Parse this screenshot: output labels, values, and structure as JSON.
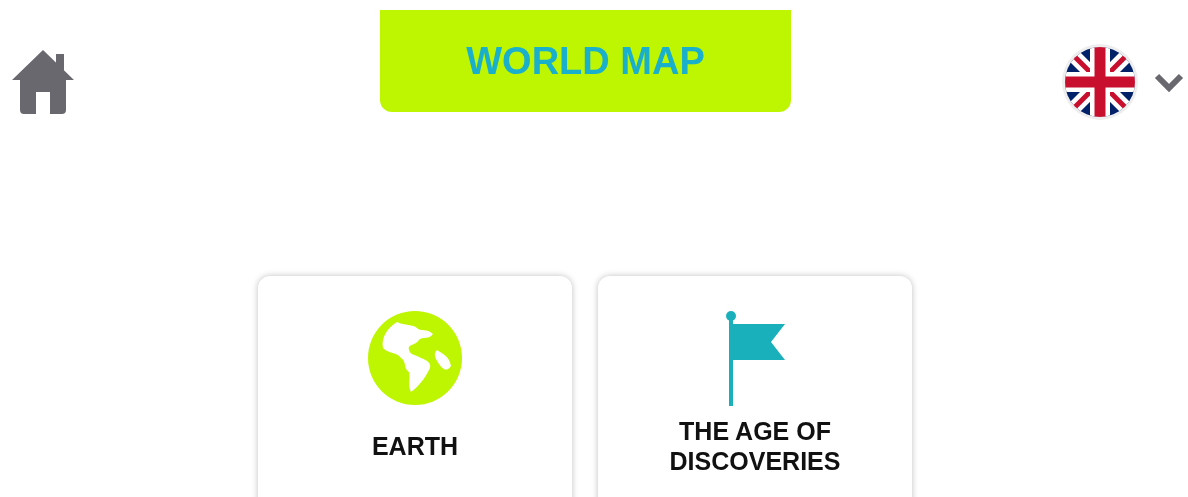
{
  "header": {
    "title": "WORLD MAP"
  },
  "cards": [
    {
      "label": "EARTH",
      "kind": "globe"
    },
    {
      "label": "THE AGE OF DISCOVERIES",
      "kind": "flag"
    }
  ]
}
